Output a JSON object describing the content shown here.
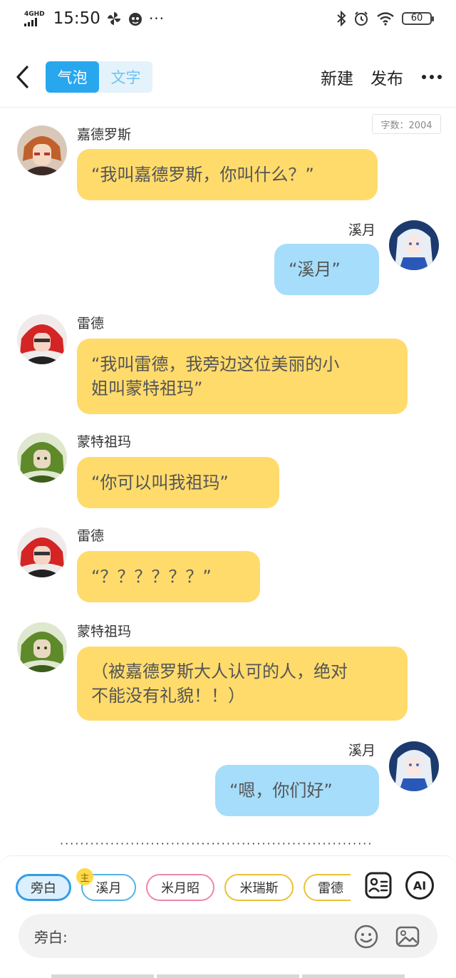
{
  "status_bar": {
    "network": "4GHD",
    "time": "15:50",
    "battery": "60"
  },
  "header": {
    "tabs": [
      {
        "label": "气泡",
        "active": true
      },
      {
        "label": "文字",
        "active": false
      }
    ],
    "new_label": "新建",
    "publish_label": "发布"
  },
  "word_count": "字数：2004",
  "messages": [
    {
      "speaker": "嘉德罗斯",
      "side": "left",
      "text_lines": [
        "“我叫嘉德罗斯，你叫什么？”"
      ]
    },
    {
      "speaker": "溪月",
      "side": "right",
      "text_lines": [
        "“溪月”"
      ]
    },
    {
      "speaker": "雷德",
      "side": "left",
      "text_lines": [
        "“我叫雷德，我旁边这位美丽的小",
        "姐叫蒙特祖玛”"
      ]
    },
    {
      "speaker": "蒙特祖玛",
      "side": "left",
      "text_lines": [
        "“你可以叫我祖玛”"
      ]
    },
    {
      "speaker": "雷德",
      "side": "left",
      "text_lines": [
        "“？？？？？？”"
      ]
    },
    {
      "speaker": "蒙特祖玛",
      "side": "left",
      "text_lines": [
        "（被嘉德罗斯大人认可的人，绝对",
        "不能没有礼貌！！）"
      ]
    },
    {
      "speaker": "溪月",
      "side": "right",
      "text_lines": [
        "“嗯，你们好”"
      ]
    }
  ],
  "ellipsis": "··································································",
  "bottom": {
    "roles": [
      {
        "label": "旁白",
        "selected": true,
        "color": "#2d9be8"
      },
      {
        "label": "溪月",
        "selected": false,
        "color": "#52b5e6"
      },
      {
        "label": "米月昭",
        "selected": false,
        "color": "#ee88a8"
      },
      {
        "label": "米瑞斯",
        "selected": false,
        "color": "#e8c23a"
      },
      {
        "label": "雷德",
        "selected": false,
        "color": "#e8c23a"
      }
    ],
    "host_badge": "主",
    "ai_label": "AI",
    "input_label": "旁白:"
  },
  "colors": {
    "accent": "#28a7ee",
    "bubble_left": "#ffdb6c",
    "bubble_right": "#a5ddfb"
  }
}
